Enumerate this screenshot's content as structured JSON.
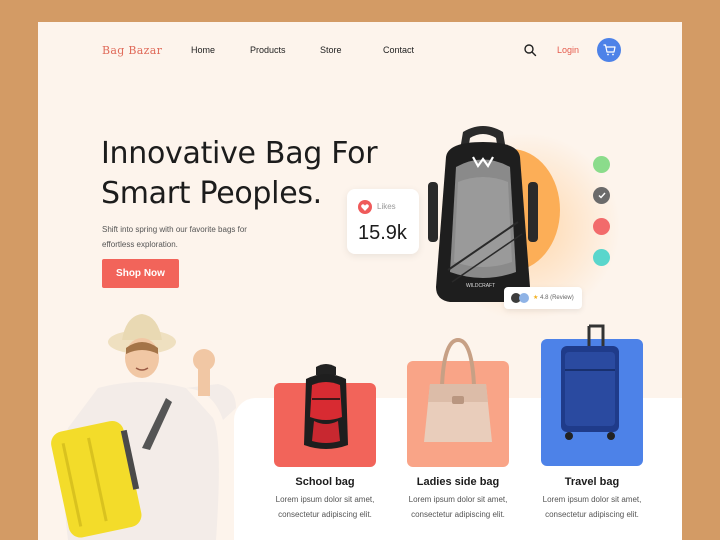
{
  "header": {
    "logo": "Bag Bazar",
    "nav": [
      "Home",
      "Products",
      "Store",
      "Contact"
    ],
    "login": "Login"
  },
  "hero": {
    "title_line1": "Innovative Bag For",
    "title_line2": "Smart Peoples.",
    "subtitle": "Shift into spring with our favorite  bags for effortless exploration.",
    "cta": "Shop Now",
    "likes_label": "Likes",
    "likes_value": "15.9k",
    "rating": "4.8",
    "rating_label": "(Review)",
    "backpack_brand": "WILDCRAFT"
  },
  "color_options": [
    "#8bdc8b",
    "#6b6b6b",
    "#f26b6b",
    "#5ad6cc"
  ],
  "products": [
    {
      "name": "School bag",
      "desc_line1": "Lorem ipsum dolor sit amet,",
      "desc_line2": "consectetur adipiscing elit.",
      "card_color": "#f2645a"
    },
    {
      "name": "Ladies side bag",
      "desc_line1": "Lorem ipsum dolor sit amet,",
      "desc_line2": "consectetur adipiscing elit.",
      "card_color": "#f9a487"
    },
    {
      "name": "Travel bag",
      "desc_line1": "Lorem ipsum dolor sit amet,",
      "desc_line2": "consectetur adipiscing elit.",
      "card_color": "#4d82e8"
    }
  ],
  "colors": {
    "accent": "#f2645a",
    "cart": "#4d82e8",
    "orb": "#fcae57",
    "background": "#d39b65",
    "page": "#fdf4ec"
  }
}
